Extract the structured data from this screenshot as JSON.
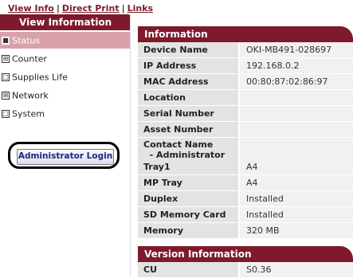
{
  "top_links": {
    "view_info": "View Info",
    "direct_print": "Direct Print",
    "links": "Links",
    "separator": "|"
  },
  "sidebar": {
    "header": "View Information",
    "items": [
      {
        "label": "Status",
        "marker": "■",
        "active": true
      },
      {
        "label": "Counter",
        "marker": "⊞",
        "active": false
      },
      {
        "label": "Supplies Life",
        "marker": "□",
        "active": false
      },
      {
        "label": "Network",
        "marker": "⊞",
        "active": false
      },
      {
        "label": "System",
        "marker": "□",
        "active": false
      }
    ],
    "admin_login": "Administrator Login"
  },
  "information": {
    "header": "Information",
    "rows": [
      {
        "label": "Device Name",
        "value": "OKI-MB491-028697"
      },
      {
        "label": "IP Address",
        "value": "192.168.0.2"
      },
      {
        "label": "MAC Address",
        "value": "00:80:87:02:86:97"
      },
      {
        "label": "Location",
        "value": ""
      },
      {
        "label": "Serial Number",
        "value": ""
      },
      {
        "label": "Asset Number",
        "value": ""
      },
      {
        "label": "Contact Name",
        "label2": "  - Administrator",
        "value": ""
      }
    ],
    "rows2": [
      {
        "label": "Tray1",
        "value": "A4"
      },
      {
        "label": "MP Tray",
        "value": "A4"
      },
      {
        "label": "Duplex",
        "value": "Installed"
      },
      {
        "label": "SD Memory Card",
        "value": "Installed"
      },
      {
        "label": "Memory",
        "value": "320 MB"
      }
    ]
  },
  "version": {
    "header": "Version Information",
    "rows": [
      {
        "label": "CU",
        "value": "S0.36"
      }
    ]
  },
  "colors": {
    "accent": "#7e1a2c",
    "active_item_bg": "#d9a2ab",
    "label_bg": "#e3e3e3",
    "value_bg": "#f1f1f1"
  }
}
